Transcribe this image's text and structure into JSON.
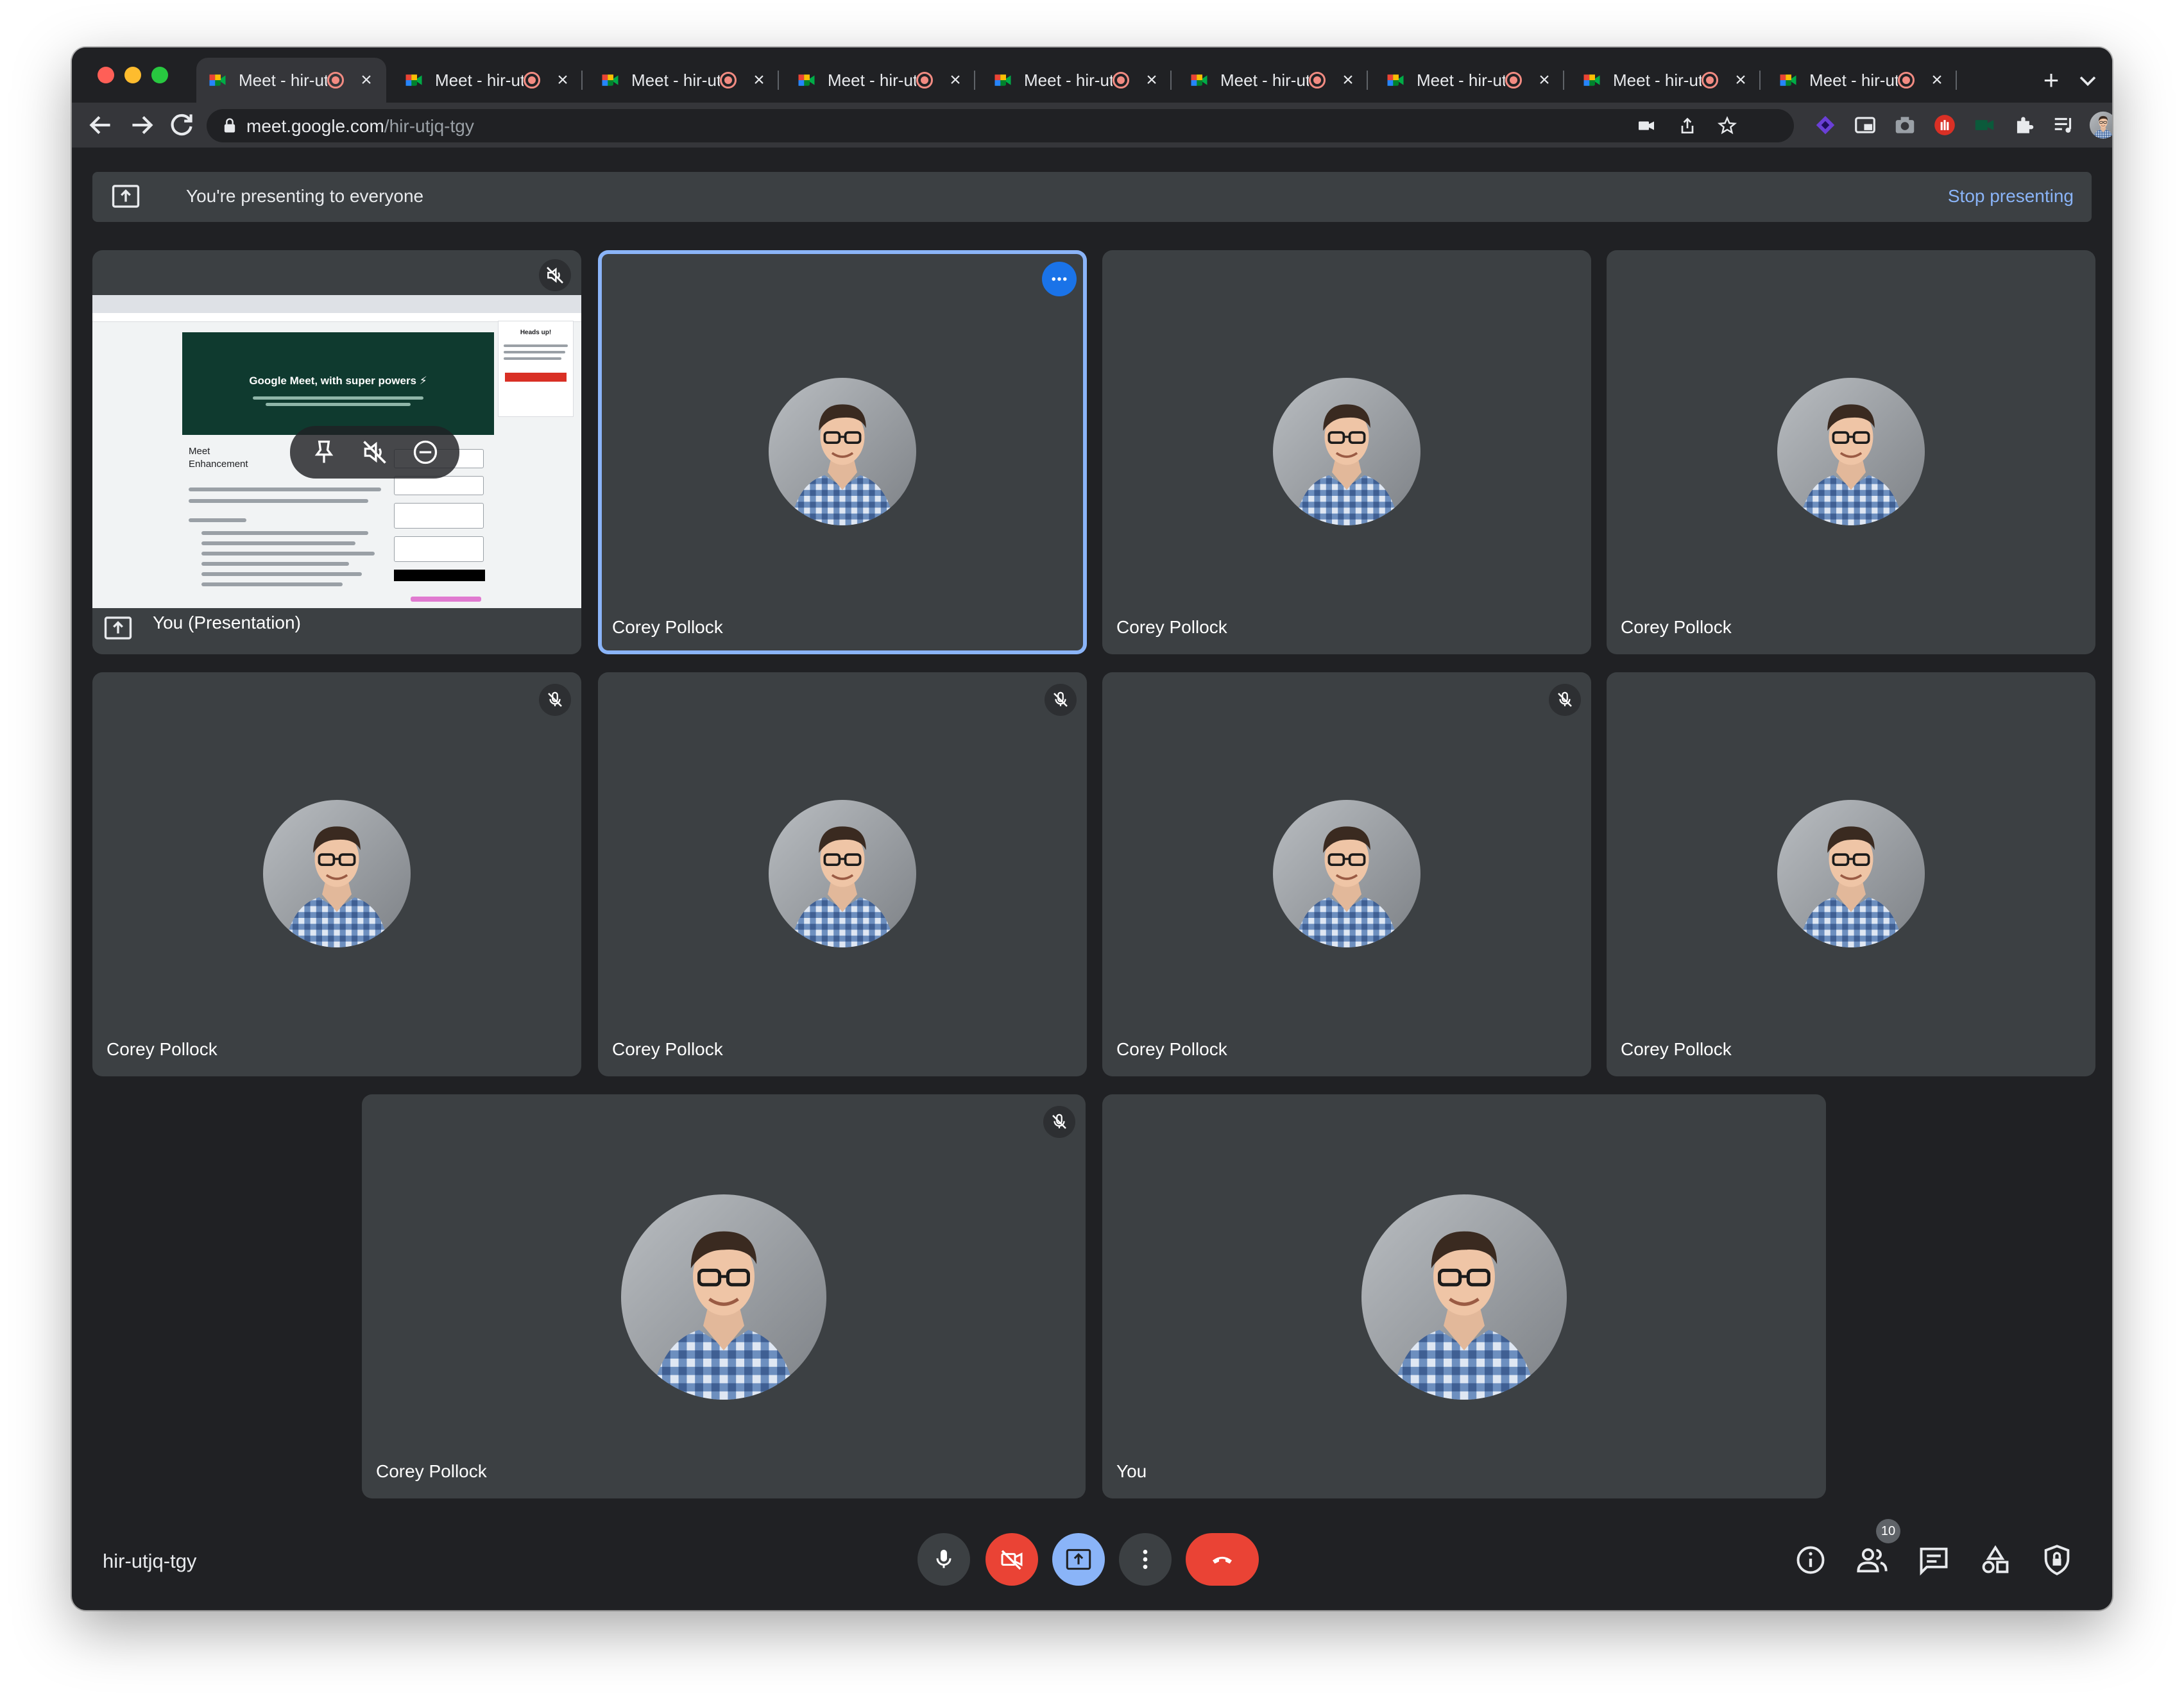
{
  "browser": {
    "tabs": [
      {
        "title": "Meet - hir-utjq-tgy",
        "active": true
      },
      {
        "title": "Meet - hir-utjq-tgy",
        "active": false
      },
      {
        "title": "Meet - hir-utjq-tgy",
        "active": false
      },
      {
        "title": "Meet - hir-utjq-tgy",
        "active": false
      },
      {
        "title": "Meet - hir-utjq-tgy",
        "active": false
      },
      {
        "title": "Meet - hir-utjq-tgy",
        "active": false
      },
      {
        "title": "Meet - hir-utjq-tgy",
        "active": false
      },
      {
        "title": "Meet - hir-utjq-tgy",
        "active": false
      },
      {
        "title": "Meet - hir-utjq-tgy",
        "active": false
      }
    ],
    "new_tab_label": "+",
    "url_host": "meet.google.com",
    "url_path": "/hir-utjq-tgy"
  },
  "banner": {
    "text": "You're presenting to everyone",
    "stop_label": "Stop presenting"
  },
  "presentation": {
    "label": "You (Presentation)",
    "hero_title": "Google Meet, with super powers ⚡",
    "side_title": "Heads up!",
    "doc_heading": "Meet Enhancement Suite Monthly Subscription"
  },
  "tiles": [
    {
      "name": "Corey Pollock"
    },
    {
      "name": "Corey Pollock"
    },
    {
      "name": "Corey Pollock"
    },
    {
      "name": "Corey Pollock"
    },
    {
      "name": "Corey Pollock"
    },
    {
      "name": "Corey Pollock"
    },
    {
      "name": "Corey Pollock"
    },
    {
      "name": "Corey Pollock"
    },
    {
      "name": "You"
    }
  ],
  "footer": {
    "meeting_code": "hir-utjq-tgy",
    "participant_count": "10"
  },
  "colors": {
    "background": "#202124",
    "tile": "#3c4043",
    "accent": "#8ab4f8",
    "camera_off": "#ea4335",
    "present_active": "#8ab4f8",
    "leave_call": "#ea4335"
  },
  "icons": {
    "mic": "microphone-icon",
    "camera": "videocam-off-icon",
    "present": "present-to-all-icon",
    "more": "more-vert-icon",
    "leave": "call-end-icon",
    "info": "info-icon",
    "people": "people-icon",
    "chat": "chat-icon",
    "activities": "activities-icon",
    "host_controls": "host-controls-icon"
  }
}
